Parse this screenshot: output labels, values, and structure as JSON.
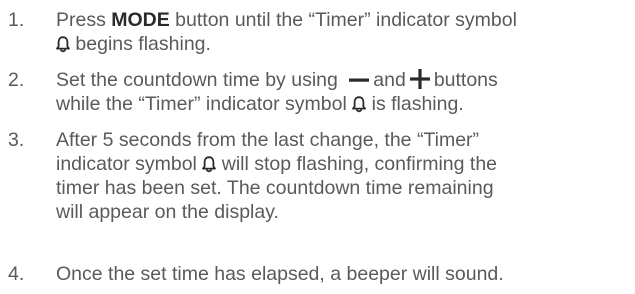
{
  "steps": [
    {
      "number": "1.",
      "lines": [
        {
          "a": "Press ",
          "bold": "MODE",
          "b": " button until the “Timer” indicator symbol"
        },
        {
          "pre": "",
          "post": " begins flashing."
        }
      ]
    },
    {
      "number": "2.",
      "lines": [
        {
          "a": "Set the countdown time by using ",
          "mid": "and",
          "b": "buttons"
        },
        {
          "pre": "while the “Timer” indicator symbol ",
          "post": " is flashing."
        }
      ]
    },
    {
      "number": "3.",
      "lines": [
        {
          "text": "After 5 seconds from the last change, the “Timer”"
        },
        {
          "pre": "indicator symbol ",
          "post": " will stop flashing, confirming the"
        },
        {
          "text": "timer has been set. The countdown time remaining"
        },
        {
          "text": "will appear on the display."
        }
      ]
    },
    {
      "number": "4.",
      "lines": [
        {
          "text": "Once the set time has elapsed, a beeper will sound."
        }
      ]
    }
  ],
  "icons": {
    "timer": "bell-icon",
    "minus": "minus-icon",
    "plus": "plus-icon"
  },
  "colors": {
    "text": "#5a5a5a",
    "bold": "#2a2a2a",
    "icon": "#2a2a2a"
  }
}
